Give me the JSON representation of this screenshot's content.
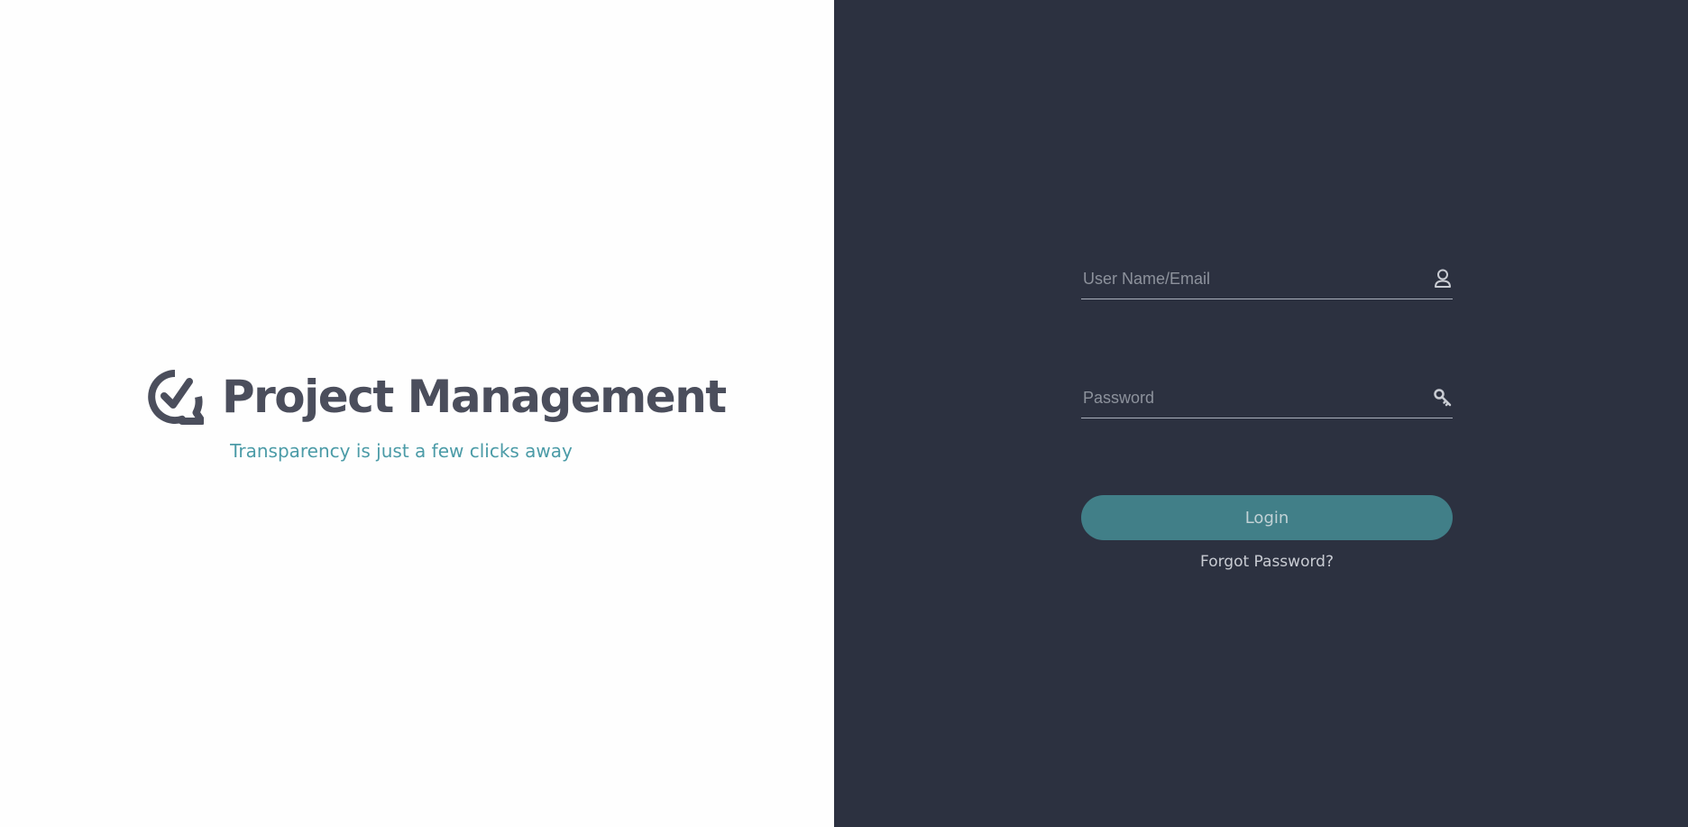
{
  "branding": {
    "logo_icon": "check-bubble-icon",
    "title": "Project Management",
    "tagline": "Transparency is just a few clicks away"
  },
  "login_form": {
    "username": {
      "placeholder": "User Name/Email",
      "value": "",
      "icon": "user-icon"
    },
    "password": {
      "placeholder": "Password",
      "value": "",
      "icon": "key-icon"
    },
    "submit_label": "Login",
    "forgot_password_label": "Forgot Password?"
  },
  "colors": {
    "left_background": "#fefefe",
    "right_background": "#2c3140",
    "brand_text": "#4b4e5c",
    "tagline": "#4b9ba7",
    "button": "#417f88",
    "button_text": "#c2d2d6"
  }
}
